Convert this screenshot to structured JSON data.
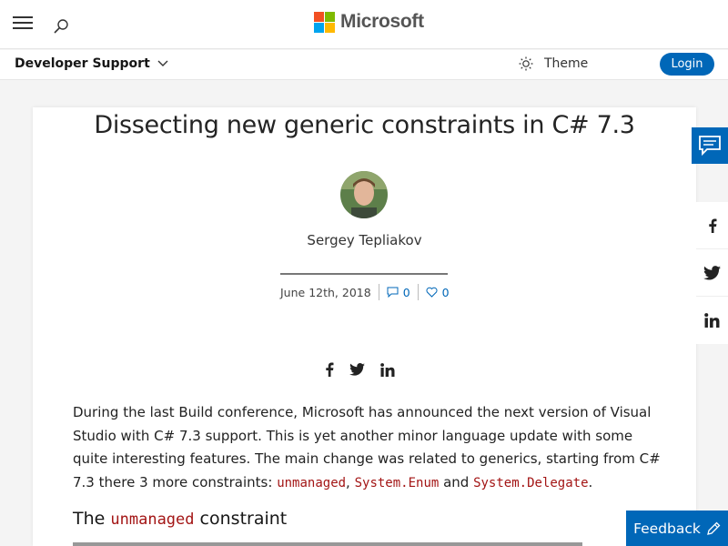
{
  "header": {
    "brand": "Microsoft",
    "brand_colors": [
      "#f25022",
      "#7fba00",
      "#00a4ef",
      "#ffb900"
    ],
    "menu_icon": "hamburger-icon",
    "search_icon": "search-icon"
  },
  "subnav": {
    "site_name": "Developer Support",
    "theme_label": "Theme",
    "login_label": "Login"
  },
  "article": {
    "title": "Dissecting new generic constraints in C# 7.3",
    "author": "Sergey Tepliakov",
    "date": "June 12th, 2018",
    "comments": "0",
    "likes": "0",
    "para1_a": "During the last Build conference, Microsoft has announced the next version of Visual Studio with C# 7.3 support. This is yet another minor language update with some quite interesting features. The main change was related to generics, starting from C# 7.3 there 3 more constraints: ",
    "code1": "unmanaged",
    "para1_b": ", ",
    "code2": "System.Enum",
    "para1_c": " and ",
    "code3": "System.Delegate",
    "para1_d": ".",
    "h2_a": "The ",
    "h2_code": "unmanaged",
    "h2_b": " constraint"
  },
  "side": {
    "feedback_label": "Feedback"
  },
  "colors": {
    "accent": "#0067b8",
    "code": "#a31515"
  }
}
